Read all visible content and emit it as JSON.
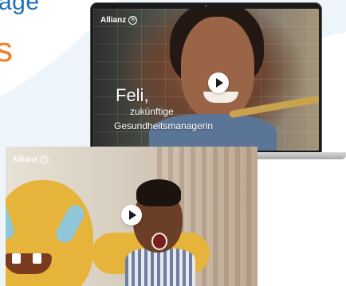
{
  "headline": {
    "fragment_top": "age",
    "fragment_mid": "s"
  },
  "colors": {
    "brand_blue": "#1f6fb6",
    "accent_orange": "#f07e26",
    "swoosh": "#e7f0f7"
  },
  "laptop_video": {
    "brand": "Allianz",
    "brand_mark": "ⓐ",
    "caption_name": "Feli,",
    "caption_line2": "zukünftige",
    "caption_line3": "Gesundheitsmanagerin",
    "play_icon": "play-icon"
  },
  "second_video": {
    "brand": "Allianz",
    "brand_mark": "ⓐ",
    "play_icon": "play-icon"
  }
}
